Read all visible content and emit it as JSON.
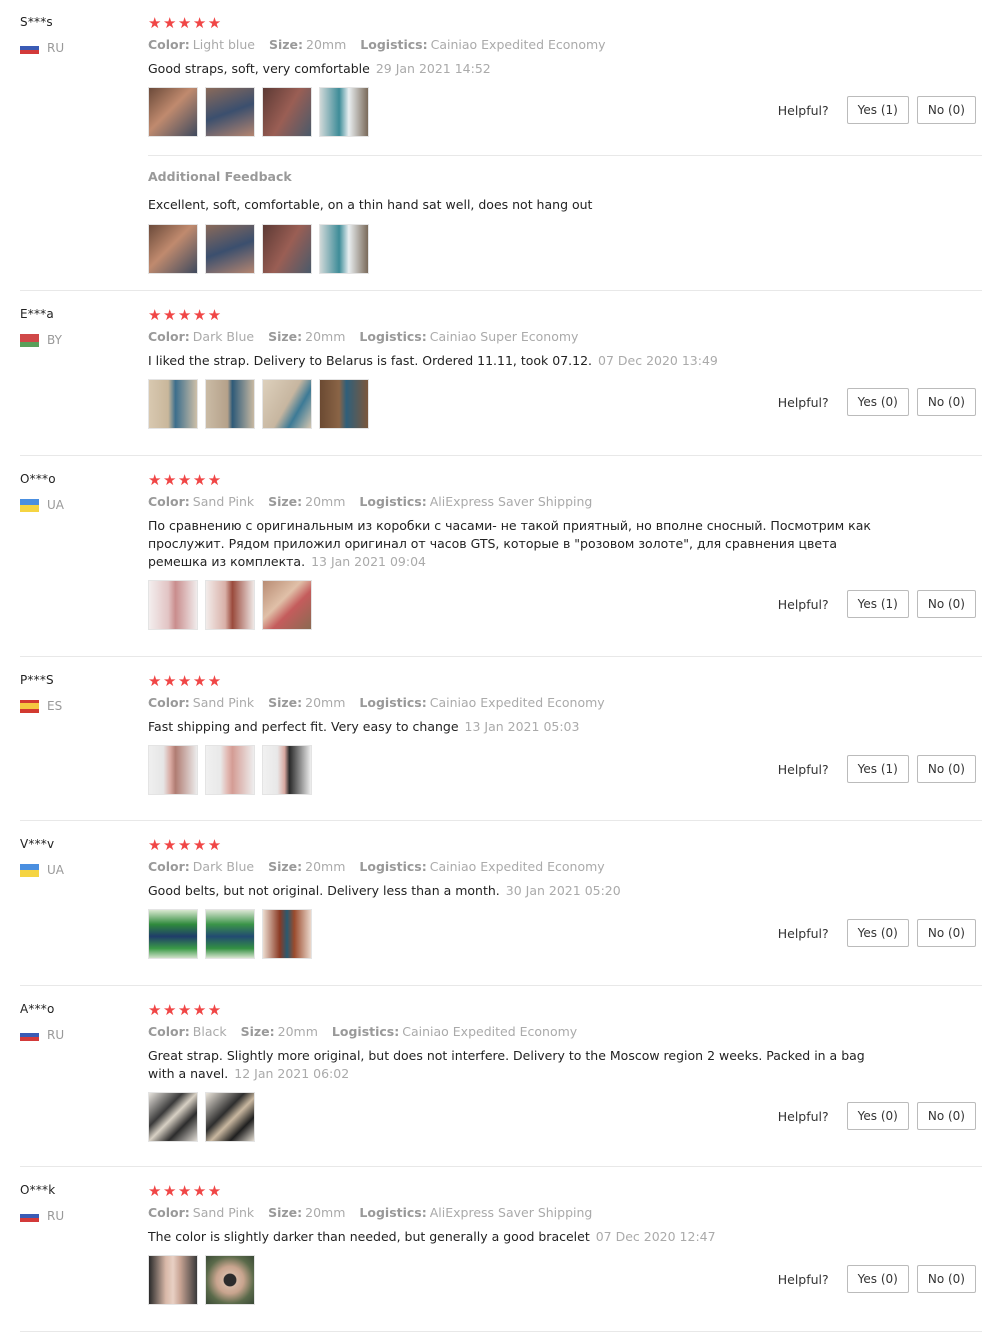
{
  "labels": {
    "color": "Color:",
    "size": "Size:",
    "logistics": "Logistics:",
    "helpful": "Helpful?",
    "additional_feedback": "Additional Feedback"
  },
  "stars": "★★★★★",
  "reviews": [
    {
      "user": "S***s",
      "country": "RU",
      "color": "Light blue",
      "size": "20mm",
      "logistics": "Cainiao Expedited Economy",
      "text": "Good straps, soft, very comfortable",
      "date": "29 Jan 2021 14:52",
      "yes": "Yes (1)",
      "no": "No (0)",
      "additional": {
        "text": "Excellent, soft, comfortable, on a thin hand sat well, does not hang out"
      }
    },
    {
      "user": "E***a",
      "country": "BY",
      "color": "Dark Blue",
      "size": "20mm",
      "logistics": "Cainiao Super Economy",
      "text": "I liked the strap. Delivery to Belarus is fast. Ordered 11.11, took 07.12.",
      "date": "07 Dec 2020 13:49",
      "yes": "Yes (0)",
      "no": "No (0)"
    },
    {
      "user": "O***o",
      "country": "UA",
      "color": "Sand Pink",
      "size": "20mm",
      "logistics": "AliExpress Saver Shipping",
      "text": "По сравнению с оригинальным из коробки с часами- не такой приятный, но вполне сносный. Посмотрим как прослужит. Рядом приложил оригинал от часов GTS, которые в \"розовом золоте\", для сравнения цвета ремешка из комплекта.",
      "date": "13 Jan 2021 09:04",
      "yes": "Yes (1)",
      "no": "No (0)"
    },
    {
      "user": "P***S",
      "country": "ES",
      "color": "Sand Pink",
      "size": "20mm",
      "logistics": "Cainiao Expedited Economy",
      "text": "Fast shipping and perfect fit. Very easy to change",
      "date": "13 Jan 2021 05:03",
      "yes": "Yes (1)",
      "no": "No (0)"
    },
    {
      "user": "V***v",
      "country": "UA",
      "color": "Dark Blue",
      "size": "20mm",
      "logistics": "Cainiao Expedited Economy",
      "text": "Good belts, but not original. Delivery less than a month.",
      "date": "30 Jan 2021 05:20",
      "yes": "Yes (0)",
      "no": "No (0)"
    },
    {
      "user": "A***o",
      "country": "RU",
      "color": "Black",
      "size": "20mm",
      "logistics": "Cainiao Expedited Economy",
      "text": "Great strap. Slightly more original, but does not interfere. Delivery to the Moscow region 2 weeks. Packed in a bag with a navel.",
      "date": "12 Jan 2021 06:02",
      "yes": "Yes (0)",
      "no": "No (0)"
    },
    {
      "user": "O***k",
      "country": "RU",
      "color": "Sand Pink",
      "size": "20mm",
      "logistics": "AliExpress Saver Shipping",
      "text": "The color is slightly darker than needed, but generally a good bracelet",
      "date": "07 Dec 2020 12:47",
      "yes": "Yes (0)",
      "no": "No (0)"
    }
  ]
}
